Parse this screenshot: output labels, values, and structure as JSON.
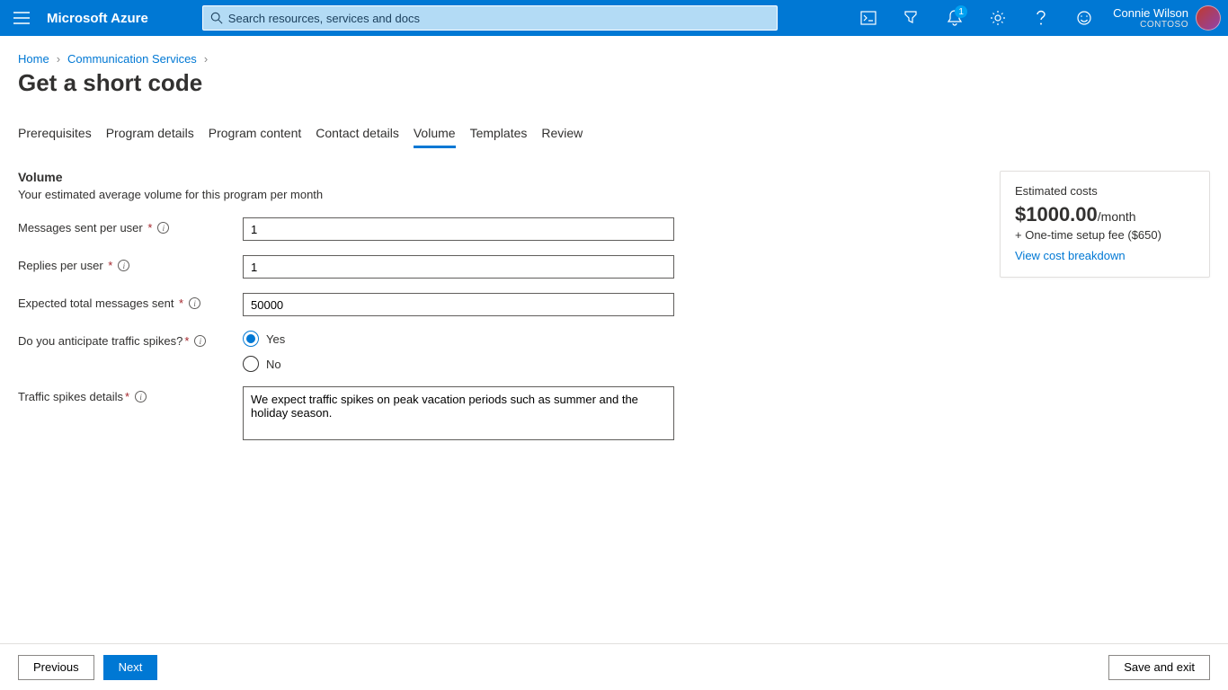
{
  "header": {
    "brand": "Microsoft Azure",
    "search_placeholder": "Search resources, services and docs",
    "notification_count": "1",
    "user_name": "Connie Wilson",
    "user_org": "CONTOSO"
  },
  "breadcrumbs": {
    "items": [
      "Home",
      "Communication Services"
    ]
  },
  "page": {
    "title": "Get a short code"
  },
  "tabs": {
    "items": [
      "Prerequisites",
      "Program details",
      "Program content",
      "Contact details",
      "Volume",
      "Templates",
      "Review"
    ],
    "active": "Volume"
  },
  "section": {
    "heading": "Volume",
    "sub": "Your estimated average volume for this program per month"
  },
  "form": {
    "messages_label": "Messages sent per user",
    "messages_value": "1",
    "replies_label": "Replies per user",
    "replies_value": "1",
    "expected_label": "Expected total messages sent",
    "expected_value": "50000",
    "spikes_label": "Do you anticipate traffic spikes?",
    "spike_yes": "Yes",
    "spike_no": "No",
    "spike_selected": "Yes",
    "details_label": "Traffic spikes details",
    "details_value": "We expect traffic spikes on peak vacation periods such as summer and the holiday season."
  },
  "cost": {
    "title": "Estimated costs",
    "value": "$1000.00",
    "per": "/month",
    "fee": "+ One-time setup fee ($650)",
    "link": "View cost breakdown"
  },
  "footer": {
    "previous": "Previous",
    "next": "Next",
    "save": "Save and exit"
  }
}
